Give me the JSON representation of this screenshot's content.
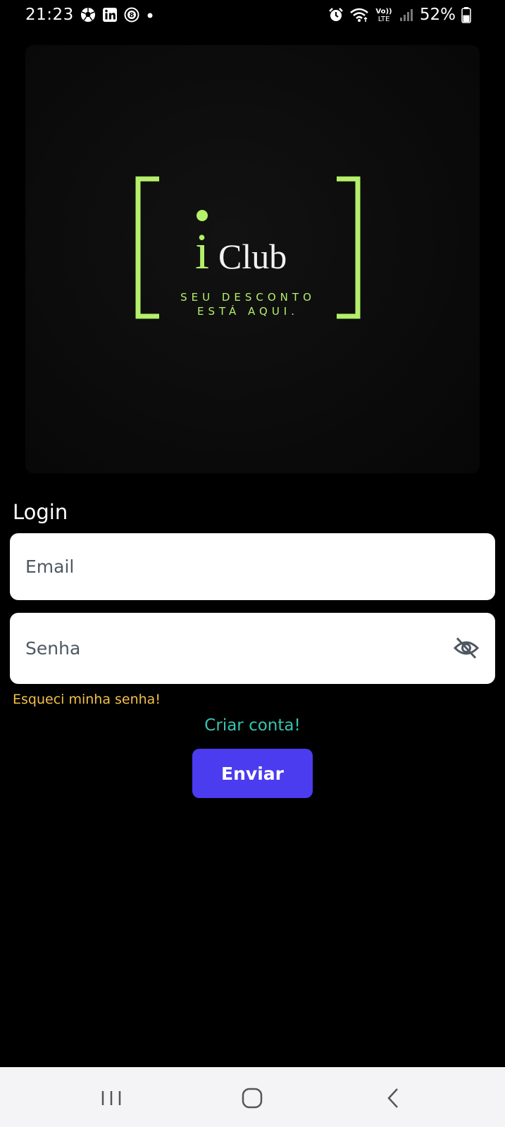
{
  "status_bar": {
    "time": "21:23",
    "left_icons": [
      "soccer-ball-icon",
      "linkedin-icon",
      "eight-ball-icon",
      "notification-dot-icon"
    ],
    "right_icons": [
      "alarm-icon",
      "wifi-icon",
      "volte-icon",
      "signal-icon"
    ],
    "volte_label": "Vo)) LTE",
    "battery_percent": "52%",
    "battery_level": 0.52
  },
  "logo": {
    "brand_i": "i",
    "brand_club": "Club",
    "tagline_line1": "SEU DESCONTO",
    "tagline_line2": "ESTÁ AQUI.",
    "accent_color": "#b4f06a"
  },
  "login": {
    "title": "Login",
    "email_placeholder": "Email",
    "email_value": "",
    "password_placeholder": "Senha",
    "password_value": "",
    "password_toggle_icon": "eye-off-icon",
    "forgot_password": "Esqueci minha senha!",
    "create_account": "Criar conta!",
    "submit_label": "Enviar"
  },
  "colors": {
    "background": "#000000",
    "forgot_link": "#f2c04a",
    "create_link": "#36c5b2",
    "submit_button": "#4b3cf0"
  },
  "nav_bar": {
    "buttons": [
      "recent-apps-icon",
      "home-icon",
      "back-icon"
    ]
  }
}
